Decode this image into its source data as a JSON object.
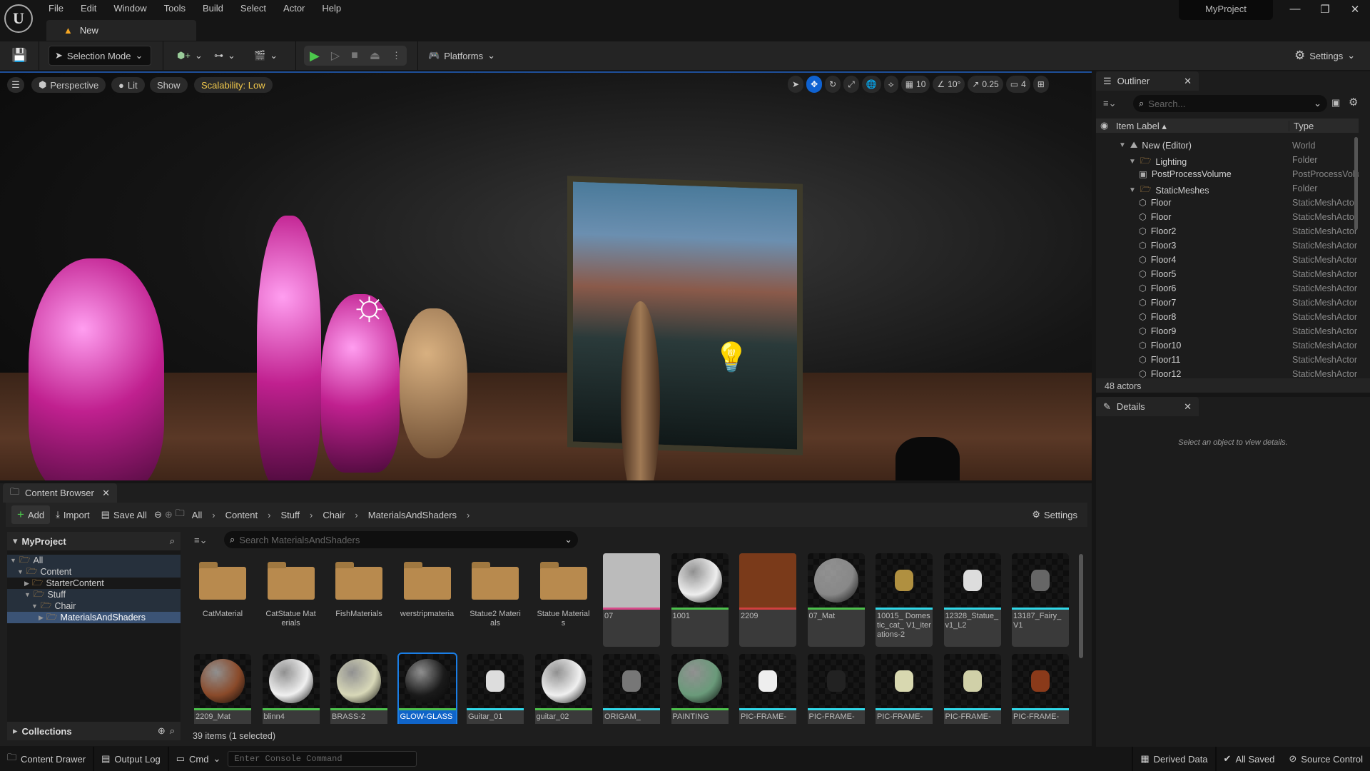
{
  "app": {
    "menu": [
      "File",
      "Edit",
      "Window",
      "Tools",
      "Build",
      "Select",
      "Actor",
      "Help"
    ],
    "doc_tab": "New",
    "project": "MyProject"
  },
  "toolbar": {
    "selection_mode": "Selection Mode",
    "platforms": "Platforms",
    "settings": "Settings"
  },
  "viewport": {
    "menu_icon": "hamburger-icon",
    "perspective": "Perspective",
    "lit": "Lit",
    "show": "Show",
    "scalability": "Scalability: Low",
    "grid_snap": "10",
    "rotation_snap": "10°",
    "scale_snap": "0.25",
    "camera_speed": "4",
    "accent": "#f2c94c"
  },
  "outliner": {
    "title": "Outliner",
    "search_placeholder": "Search...",
    "col_label": "Item Label",
    "col_type": "Type",
    "actors_count": "48 actors",
    "rows": [
      {
        "label": "New (Editor)",
        "type": "World",
        "depth": 0,
        "icon": "world-icon",
        "expanded": true
      },
      {
        "label": "Lighting",
        "type": "Folder",
        "depth": 1,
        "icon": "folder-icon",
        "expanded": true
      },
      {
        "label": "PostProcessVolume",
        "type": "PostProcessVolume",
        "depth": 2,
        "icon": "volume-icon"
      },
      {
        "label": "StaticMeshes",
        "type": "Folder",
        "depth": 1,
        "icon": "folder-icon",
        "expanded": true
      },
      {
        "label": "Floor",
        "type": "StaticMeshActor",
        "depth": 2,
        "icon": "mesh-icon"
      },
      {
        "label": "Floor",
        "type": "StaticMeshActor",
        "depth": 2,
        "icon": "mesh-icon"
      },
      {
        "label": "Floor2",
        "type": "StaticMeshActor",
        "depth": 2,
        "icon": "mesh-icon"
      },
      {
        "label": "Floor3",
        "type": "StaticMeshActor",
        "depth": 2,
        "icon": "mesh-icon"
      },
      {
        "label": "Floor4",
        "type": "StaticMeshActor",
        "depth": 2,
        "icon": "mesh-icon"
      },
      {
        "label": "Floor5",
        "type": "StaticMeshActor",
        "depth": 2,
        "icon": "mesh-icon"
      },
      {
        "label": "Floor6",
        "type": "StaticMeshActor",
        "depth": 2,
        "icon": "mesh-icon"
      },
      {
        "label": "Floor7",
        "type": "StaticMeshActor",
        "depth": 2,
        "icon": "mesh-icon"
      },
      {
        "label": "Floor8",
        "type": "StaticMeshActor",
        "depth": 2,
        "icon": "mesh-icon"
      },
      {
        "label": "Floor9",
        "type": "StaticMeshActor",
        "depth": 2,
        "icon": "mesh-icon"
      },
      {
        "label": "Floor10",
        "type": "StaticMeshActor",
        "depth": 2,
        "icon": "mesh-icon"
      },
      {
        "label": "Floor11",
        "type": "StaticMeshActor",
        "depth": 2,
        "icon": "mesh-icon"
      },
      {
        "label": "Floor12",
        "type": "StaticMeshActor",
        "depth": 2,
        "icon": "mesh-icon"
      }
    ]
  },
  "details": {
    "title": "Details",
    "empty": "Select an object to view details."
  },
  "content_browser": {
    "title": "Content Browser",
    "add": "Add",
    "import": "Import",
    "save_all": "Save All",
    "settings": "Settings",
    "breadcrumb": [
      "All",
      "Content",
      "Stuff",
      "Chair",
      "MaterialsAndShaders"
    ],
    "root": "MyProject",
    "search_placeholder": "Search MaterialsAndShaders",
    "collections": "Collections",
    "status": "39 items (1 selected)",
    "tree": [
      {
        "label": "All",
        "depth": 0
      },
      {
        "label": "Content",
        "depth": 1
      },
      {
        "label": "StarterContent",
        "depth": 2,
        "collapsed": true
      },
      {
        "label": "Stuff",
        "depth": 2
      },
      {
        "label": "Chair",
        "depth": 3
      },
      {
        "label": "MaterialsAndShaders",
        "depth": 4,
        "selected": true,
        "collapsed": true
      }
    ],
    "assets": [
      {
        "name": "CatMaterial",
        "kind": "folder"
      },
      {
        "name": "CatStatue Materials",
        "kind": "folder"
      },
      {
        "name": "FishMaterials",
        "kind": "folder"
      },
      {
        "name": "werstripmateria",
        "kind": "folder"
      },
      {
        "name": "Statue2 Materials",
        "kind": "folder"
      },
      {
        "name": "Statue Materials",
        "kind": "folder"
      },
      {
        "name": "07",
        "kind": "texture",
        "color": "#d84a8a",
        "thumb": "#bbb"
      },
      {
        "name": "1001",
        "kind": "material",
        "color": "#4cc04c",
        "thumb": "#eee"
      },
      {
        "name": "2209",
        "kind": "texture",
        "color": "#d04040",
        "thumb": "#7a3a1a"
      },
      {
        "name": "07_Mat",
        "kind": "material",
        "color": "#4cc04c",
        "thumb": "#888"
      },
      {
        "name": "10015_ Domestic_cat_ V1_iterations-2",
        "kind": "mesh",
        "color": "#30d8e8",
        "thumb": "#b09040"
      },
      {
        "name": "12328_Statue_ v1_L2",
        "kind": "mesh",
        "color": "#30d8e8",
        "thumb": "#ddd"
      },
      {
        "name": "13187_Fairy_ V1",
        "kind": "mesh",
        "color": "#30d8e8",
        "thumb": "#666"
      },
      {
        "name": "2209_Mat",
        "kind": "material",
        "color": "#4cc04c",
        "thumb": "#8a4a2a"
      },
      {
        "name": "blinn4",
        "kind": "material",
        "color": "#4cc04c",
        "thumb": "#f0f0f0"
      },
      {
        "name": "BRASS-2",
        "kind": "material",
        "color": "#4cc04c",
        "thumb": "#d8d8b8"
      },
      {
        "name": "GLOW-GLASS",
        "kind": "material",
        "color": "#4cc04c",
        "thumb": "#1a1a1a",
        "selected": true
      },
      {
        "name": "Guitar_01",
        "kind": "mesh",
        "color": "#30d8e8",
        "thumb": "#ddd"
      },
      {
        "name": "guitar_02",
        "kind": "material",
        "color": "#4cc04c",
        "thumb": "#f0f0f0"
      },
      {
        "name": "ORIGAM_",
        "kind": "mesh",
        "color": "#30d8e8",
        "thumb": "#777"
      },
      {
        "name": "PAINTING",
        "kind": "material",
        "color": "#4cc04c",
        "thumb": "#6a9a7a"
      },
      {
        "name": "PIC-FRAME-",
        "kind": "mesh",
        "color": "#30d8e8",
        "thumb": "#eee"
      },
      {
        "name": "PIC-FRAME-",
        "kind": "mesh",
        "color": "#30d8e8",
        "thumb": "#222"
      },
      {
        "name": "PIC-FRAME-",
        "kind": "mesh",
        "color": "#30d8e8",
        "thumb": "#d8d8b0"
      },
      {
        "name": "PIC-FRAME-",
        "kind": "mesh",
        "color": "#30d8e8",
        "thumb": "#d0d0a8"
      },
      {
        "name": "PIC-FRAME-",
        "kind": "mesh",
        "color": "#30d8e8",
        "thumb": "#8a3a1a"
      }
    ]
  },
  "statusbar": {
    "content_drawer": "Content Drawer",
    "output_log": "Output Log",
    "cmd": "Cmd",
    "console_placeholder": "Enter Console Command",
    "derived_data": "Derived Data",
    "all_saved": "All Saved",
    "source_control": "Source Control"
  }
}
